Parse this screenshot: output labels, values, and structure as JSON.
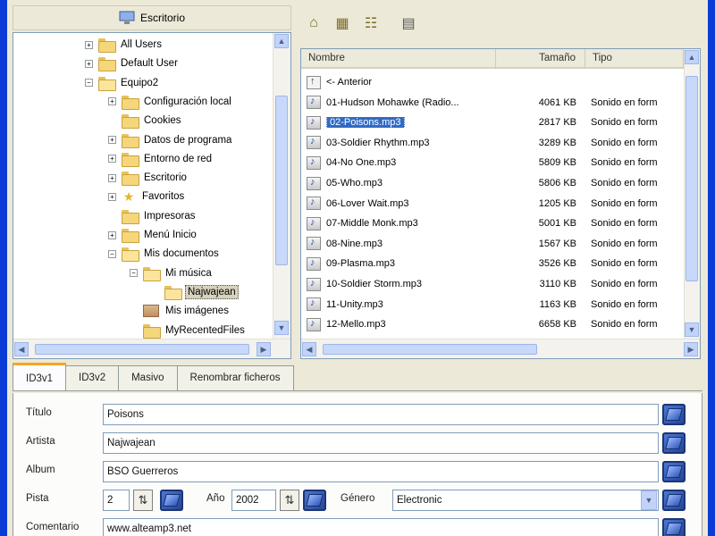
{
  "tree": {
    "header_label": "Escritorio",
    "items": [
      {
        "label": "All Users",
        "icon": "folder-icon",
        "expander": "+"
      },
      {
        "label": "Default User",
        "icon": "folder-icon",
        "expander": "+"
      },
      {
        "label": "Equipo2",
        "icon": "folder-open-icon",
        "expander": "−"
      },
      {
        "label": "Configuración local",
        "icon": "folder-icon",
        "expander": "+"
      },
      {
        "label": "Cookies",
        "icon": "folder-icon",
        "expander": ""
      },
      {
        "label": "Datos de programa",
        "icon": "folder-icon",
        "expander": "+"
      },
      {
        "label": "Entorno de red",
        "icon": "folder-icon",
        "expander": "+"
      },
      {
        "label": "Escritorio",
        "icon": "folder-icon",
        "expander": "+"
      },
      {
        "label": "Favoritos",
        "icon": "favorites-star-icon",
        "expander": "+"
      },
      {
        "label": "Impresoras",
        "icon": "folder-icon",
        "expander": ""
      },
      {
        "label": "Menú Inicio",
        "icon": "folder-icon",
        "expander": "+"
      },
      {
        "label": "Mis documentos",
        "icon": "folder-open-icon",
        "expander": "−"
      },
      {
        "label": "Mi música",
        "icon": "folder-open-icon",
        "expander": "−"
      },
      {
        "label": "Najwajean",
        "icon": "folder-open-icon",
        "expander": ""
      },
      {
        "label": "Mis imágenes",
        "icon": "pictures-folder-icon",
        "expander": ""
      },
      {
        "label": "MyRecentedFiles",
        "icon": "folder-icon",
        "expander": ""
      }
    ]
  },
  "toolbar": {
    "buttons": [
      "home-folder-icon",
      "grid-view-icon",
      "list-view-icon",
      "save-disk-icon"
    ]
  },
  "file_list": {
    "columns": {
      "name": "Nombre",
      "size": "Tamaño",
      "type": "Tipo"
    },
    "rows": [
      {
        "name": "<- Anterior",
        "size": "",
        "type": ""
      },
      {
        "name": "01-Hudson Mohawke (Radio...",
        "size": "4061 KB",
        "type": "Sonido en form"
      },
      {
        "name": "02-Poisons.mp3",
        "size": "2817 KB",
        "type": "Sonido en form"
      },
      {
        "name": "03-Soldier Rhythm.mp3",
        "size": "3289 KB",
        "type": "Sonido en form"
      },
      {
        "name": "04-No One.mp3",
        "size": "5809 KB",
        "type": "Sonido en form"
      },
      {
        "name": "05-Who.mp3",
        "size": "5806 KB",
        "type": "Sonido en form"
      },
      {
        "name": "06-Lover Wait.mp3",
        "size": "1205 KB",
        "type": "Sonido en form"
      },
      {
        "name": "07-Middle Monk.mp3",
        "size": "5001 KB",
        "type": "Sonido en form"
      },
      {
        "name": "08-Nine.mp3",
        "size": "1567 KB",
        "type": "Sonido en form"
      },
      {
        "name": "09-Plasma.mp3",
        "size": "3526 KB",
        "type": "Sonido en form"
      },
      {
        "name": "10-Soldier Storm.mp3",
        "size": "3110 KB",
        "type": "Sonido en form"
      },
      {
        "name": "11-Unity.mp3",
        "size": "1163 KB",
        "type": "Sonido en form"
      },
      {
        "name": "12-Mello.mp3",
        "size": "6658 KB",
        "type": "Sonido en form"
      }
    ]
  },
  "tabs": [
    "ID3v1",
    "ID3v2",
    "Masivo",
    "Renombrar ficheros"
  ],
  "form": {
    "title_label": "Título",
    "title_value": "Poisons",
    "artist_label": "Artista",
    "artist_value": "Najwajean",
    "album_label": "Album",
    "album_value": "BSO Guerreros",
    "track_label": "Pista",
    "track_value": "2",
    "year_label": "Año",
    "year_value": "2002",
    "genre_label": "Género",
    "genre_value": "Electronic",
    "comment_label": "Comentario",
    "comment_value": "www.alteamp3.net"
  }
}
